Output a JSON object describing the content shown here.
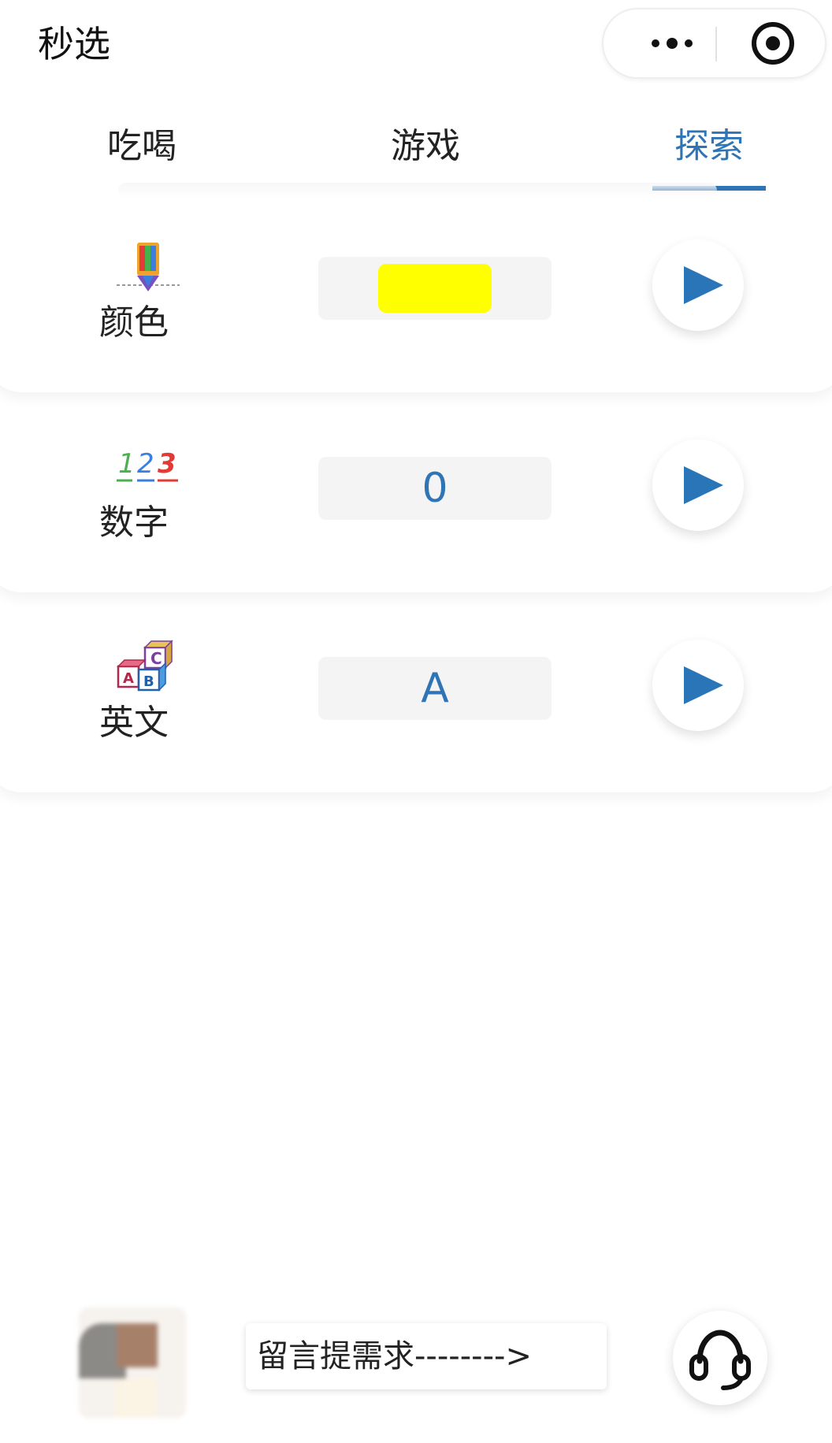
{
  "app": {
    "title": "秒选"
  },
  "tabs": [
    {
      "label": "吃喝",
      "active": false
    },
    {
      "label": "游戏",
      "active": false
    },
    {
      "label": "探索",
      "active": true
    }
  ],
  "cards": [
    {
      "label": "颜色",
      "icon": "pencil-color-icon",
      "value_display": "",
      "swatch_color": "#ffff00"
    },
    {
      "label": "数字",
      "icon": "numbers-123-icon",
      "value_display": "0"
    },
    {
      "label": "英文",
      "icon": "abc-blocks-icon",
      "value_display": "A"
    }
  ],
  "footer": {
    "message_label": "留言提需求-------->"
  },
  "colors": {
    "accent": "#2f74b5",
    "play": "#2a74b8",
    "swatch_yellow": "#ffff00"
  }
}
